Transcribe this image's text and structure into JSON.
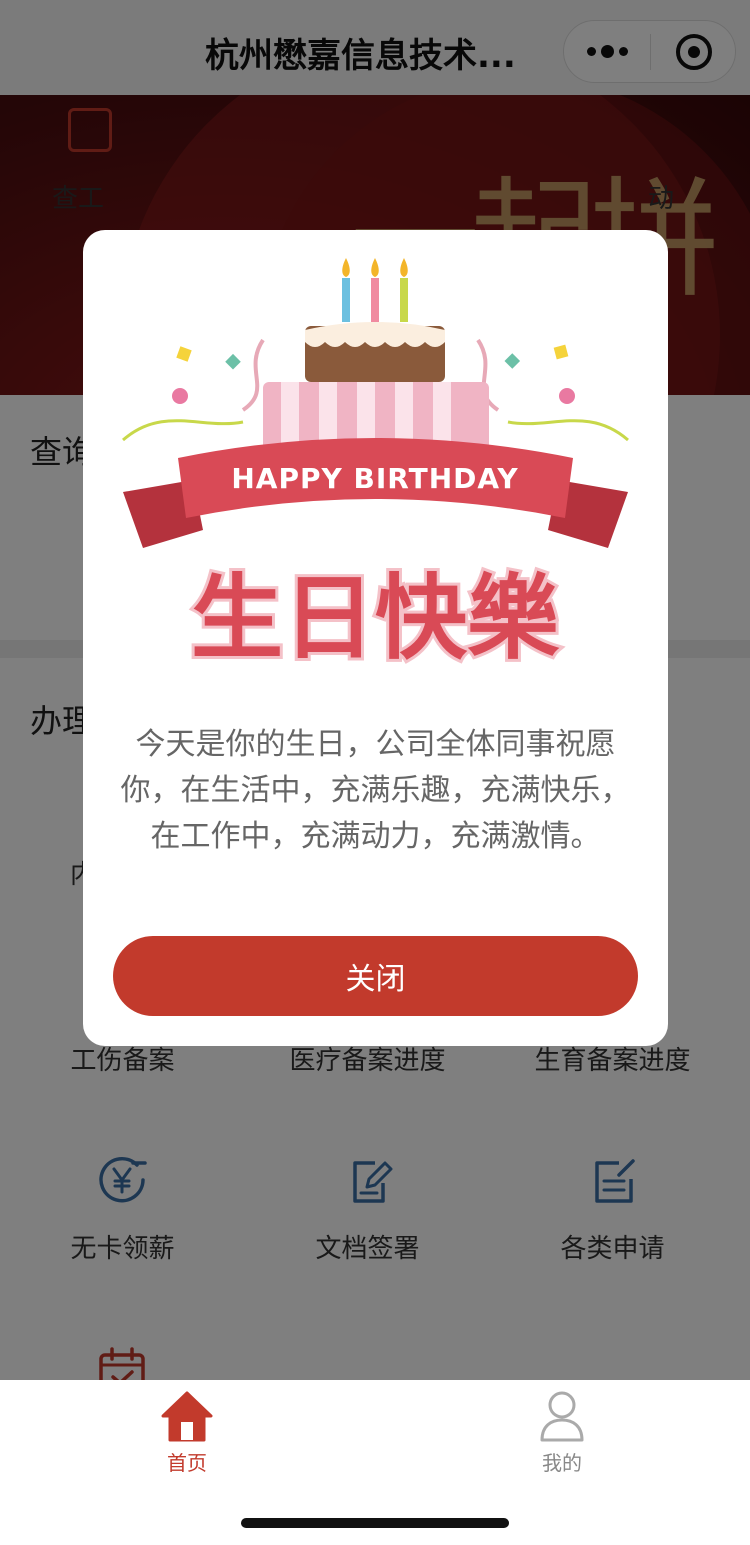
{
  "nav": {
    "title": "杭州懋嘉信息技术..."
  },
  "banner": {
    "calligraphy": "一起拼"
  },
  "query_section": {
    "title": "查询",
    "left_item_label": "查工",
    "right_item_label": "动"
  },
  "handle_section": {
    "title": "办理",
    "partial_item_label": "内",
    "items": [
      {
        "label": "工伤备案",
        "icon": "none"
      },
      {
        "label": "医疗备案进度",
        "icon": "none"
      },
      {
        "label": "生育备案进度",
        "icon": "none"
      },
      {
        "label": "无卡领薪",
        "icon": "yen-circle-icon"
      },
      {
        "label": "文档签署",
        "icon": "document-sign-icon"
      },
      {
        "label": "各类申请",
        "icon": "edit-form-icon"
      },
      {
        "label": "",
        "icon": "calendar-check-icon"
      }
    ]
  },
  "modal": {
    "banner_text_en": "HAPPY BIRTHDAY",
    "banner_text_cn": "生日快樂",
    "message": "今天是你的生日，公司全体同事祝愿你，在生活中，充满乐趣，充满快乐，在工作中，充满动力，充满激情。",
    "close_label": "关闭"
  },
  "tabbar": {
    "tabs": [
      {
        "label": "首页",
        "icon": "home-icon",
        "active": true
      },
      {
        "label": "我的",
        "icon": "user-icon",
        "active": false
      }
    ]
  },
  "colors": {
    "accent": "#c23a2c",
    "banner_red": "#6e1414",
    "icon_blue": "#3a6ea5",
    "inactive": "#888888"
  }
}
